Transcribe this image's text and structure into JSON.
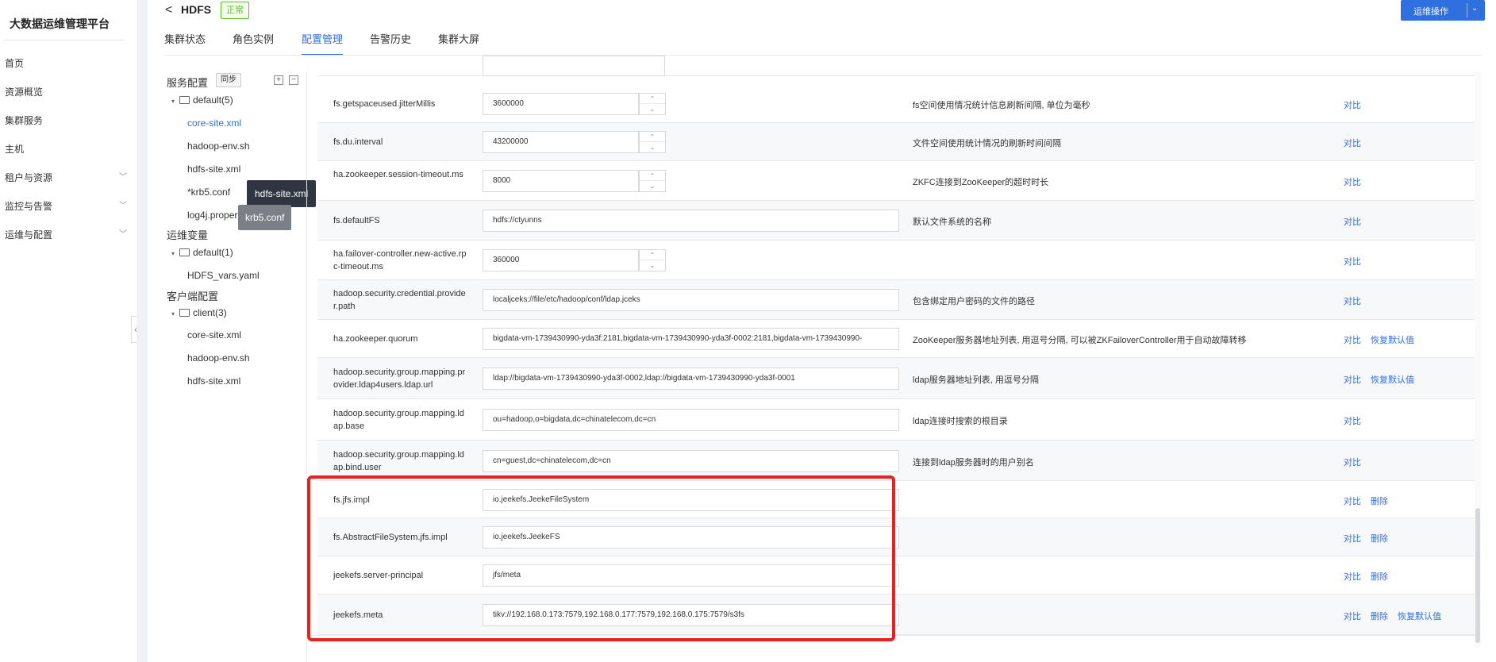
{
  "app": {
    "brand": "大数据运维管理平台"
  },
  "nav": {
    "items": [
      {
        "label": "首页",
        "expandable": false
      },
      {
        "label": "资源概览",
        "expandable": false
      },
      {
        "label": "集群服务",
        "expandable": false
      },
      {
        "label": "主机",
        "expandable": false
      },
      {
        "label": "租户与资源",
        "expandable": true
      },
      {
        "label": "监控与告警",
        "expandable": true
      },
      {
        "label": "运维与配置",
        "expandable": true
      }
    ],
    "collapse_glyph": "‹"
  },
  "header": {
    "back_glyph": "<",
    "title": "HDFS",
    "status": "正常",
    "ops_button": "运维操作",
    "ops_chevron": "⌄"
  },
  "tabs": [
    {
      "label": "集群状态",
      "active": false
    },
    {
      "label": "角色实例",
      "active": false
    },
    {
      "label": "配置管理",
      "active": true
    },
    {
      "label": "告警历史",
      "active": false
    },
    {
      "label": "集群大屏",
      "active": false
    }
  ],
  "tree": {
    "service_config": "服务配置",
    "sync": "同步",
    "expand_glyph": "+",
    "collapse_glyph": "−",
    "default_group": "default(5)",
    "default_files": [
      "core-site.xml",
      "hadoop-env.sh",
      "hdfs-site.xml",
      "*krb5.conf",
      "log4j.properties"
    ],
    "ops_vars": "运维变量",
    "ops_group": "default(1)",
    "ops_files": [
      "HDFS_vars.yaml"
    ],
    "client_config": "客户端配置",
    "client_group": "client(3)",
    "client_files": [
      "core-site.xml",
      "hadoop-env.sh",
      "hdfs-site.xml"
    ],
    "caret": "▾",
    "tooltip_primary": "hdfs-site.xml",
    "tooltip_secondary": "krb5.conf"
  },
  "stepper": {
    "up": "⌃",
    "down": "⌄"
  },
  "actions": {
    "compare": "对比",
    "restore": "恢复默认值",
    "delete": "删除"
  },
  "rows": [
    {
      "key": "fs.getspaceused.jitterMillis",
      "value": "3600000",
      "stepper": true,
      "desc": "fs空间使用情况统计信息刷新间隔, 单位为毫秒",
      "actions": [
        "compare"
      ]
    },
    {
      "key": "fs.du.interval",
      "value": "43200000",
      "stepper": true,
      "desc": "文件空间使用统计情况的刷新时间间隔",
      "actions": [
        "compare"
      ]
    },
    {
      "key": "ha.zookeeper.session-timeout.ms",
      "value": "8000",
      "stepper": true,
      "desc": "ZKFC连接到ZooKeeper的超时时长",
      "actions": [
        "compare"
      ]
    },
    {
      "key": "fs.defaultFS",
      "value": "hdfs://ctyunns",
      "stepper": false,
      "desc": "默认文件系统的名称",
      "actions": [
        "compare"
      ]
    },
    {
      "key": "ha.failover-controller.new-active.rpc-timeout.ms",
      "value": "360000",
      "stepper": true,
      "desc": "",
      "actions": [
        "compare"
      ]
    },
    {
      "key": "hadoop.security.credential.provider.path",
      "value": "localjceks://file/etc/hadoop/conf/ldap.jceks",
      "stepper": false,
      "desc": "包含绑定用户密码的文件的路径",
      "actions": [
        "compare"
      ]
    },
    {
      "key": "ha.zookeeper.quorum",
      "value": "bigdata-vm-1739430990-yda3f:2181,bigdata-vm-1739430990-yda3f-0002:2181,bigdata-vm-1739430990-",
      "stepper": false,
      "desc": "ZooKeeper服务器地址列表, 用逗号分隔, 可以被ZKFailoverController用于自动故障转移",
      "actions": [
        "compare",
        "restore"
      ]
    },
    {
      "key": "hadoop.security.group.mapping.provider.ldap4users.ldap.url",
      "value": "ldap://bigdata-vm-1739430990-yda3f-0002,ldap://bigdata-vm-1739430990-yda3f-0001",
      "stepper": false,
      "desc": "ldap服务器地址列表, 用逗号分隔",
      "actions": [
        "compare",
        "restore"
      ]
    },
    {
      "key": "hadoop.security.group.mapping.ldap.base",
      "value": "ou=hadoop,o=bigdata,dc=chinatelecom,dc=cn",
      "stepper": false,
      "desc": "ldap连接时搜索的根目录",
      "actions": [
        "compare"
      ]
    },
    {
      "key": "hadoop.security.group.mapping.ldap.bind.user",
      "value": "cn=guest,dc=chinatelecom,dc=cn",
      "stepper": false,
      "desc": "连接到ldap服务器时的用户别名",
      "actions": [
        "compare"
      ]
    },
    {
      "key": "fs.jfs.impl",
      "value": "io.jeekefs.JeekeFileSystem",
      "stepper": false,
      "desc": "",
      "actions": [
        "compare",
        "delete"
      ]
    },
    {
      "key": "fs.AbstractFileSystem.jfs.impl",
      "value": "io.jeekefs.JeekeFS",
      "stepper": false,
      "desc": "",
      "actions": [
        "compare",
        "delete"
      ]
    },
    {
      "key": "jeekefs.server-principal",
      "value": "jfs/meta",
      "stepper": false,
      "desc": "",
      "actions": [
        "compare",
        "delete"
      ]
    },
    {
      "key": "jeekefs.meta",
      "value": "tikv://192.168.0.173:7579,192.168.0.177:7579,192.168.0.175:7579/s3fs",
      "stepper": false,
      "desc": "",
      "actions": [
        "compare",
        "delete",
        "restore"
      ]
    }
  ],
  "colors": {
    "accent": "#2f6fe0",
    "success": "#52c41a",
    "highlight": "#e8201f"
  }
}
